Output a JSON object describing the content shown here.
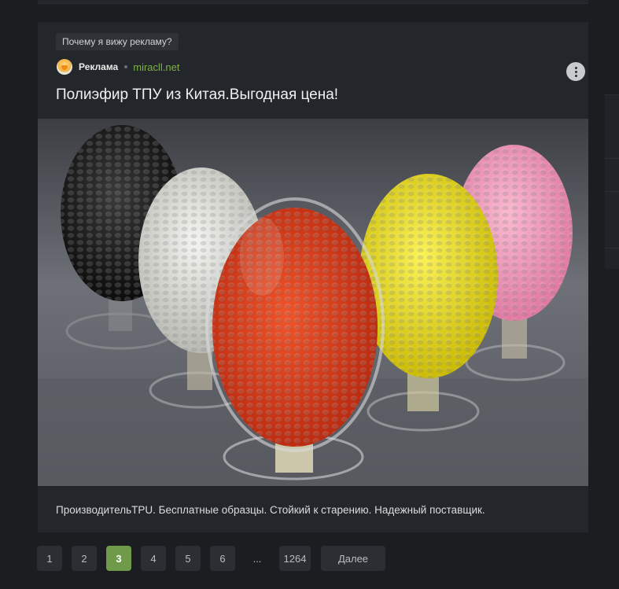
{
  "ad": {
    "why_label": "Почему я вижу рекламу?",
    "sponsor_label": "Реклама",
    "domain": "miracll.net",
    "title": "Полиэфир ТПУ из Китая.Выгодная цена!",
    "description": "ПроизводительTPU. Бесплатные образцы. Стойкий к старению. Надежный поставщик.",
    "image_subject": "egg-shaped glass vials filled with black, white, red, yellow and pink plastic pellets",
    "more_icon": "kebab-vertical-icon"
  },
  "pagination": {
    "pages": [
      "1",
      "2",
      "3",
      "4",
      "5",
      "6"
    ],
    "current": "3",
    "ellipsis": "...",
    "last": "1264",
    "next_label": "Далее"
  },
  "colors": {
    "background": "#1b1d20",
    "card": "#23272b",
    "accent_green": "#6f9a4a",
    "link_green": "#7fb04a"
  }
}
